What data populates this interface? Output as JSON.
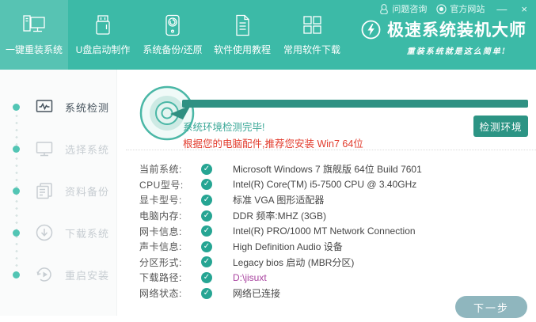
{
  "titlebar": {
    "help_label": "问题咨询",
    "official_label": "官方网站",
    "minimize_glyph": "—",
    "close_glyph": "×"
  },
  "header": {
    "tabs": [
      {
        "label": "一键重装系统",
        "icon": "computer-icon",
        "active": true
      },
      {
        "label": "U盘启动制作",
        "icon": "usb-drive-icon",
        "active": false
      },
      {
        "label": "系统备份/还原",
        "icon": "backup-restore-icon",
        "active": false
      },
      {
        "label": "软件使用教程",
        "icon": "tutorial-document-icon",
        "active": false
      },
      {
        "label": "常用软件下载",
        "icon": "apps-grid-icon",
        "active": false
      }
    ],
    "brand": {
      "title": "极速系统装机大师",
      "tagline": "重装系统就是这么简单!"
    }
  },
  "sidebar": {
    "steps": [
      {
        "label": "系统检测",
        "icon": "monitor-pulse-icon",
        "active": true
      },
      {
        "label": "选择系统",
        "icon": "monitor-icon",
        "active": false
      },
      {
        "label": "资料备份",
        "icon": "documents-icon",
        "active": false
      },
      {
        "label": "下载系统",
        "icon": "download-circle-icon",
        "active": false
      },
      {
        "label": "重启安装",
        "icon": "restart-icon",
        "active": false
      }
    ]
  },
  "main": {
    "progress_percent": 100,
    "status": "系统环境检测完毕!",
    "recommendation": "根据您的电脑配件,推荐您安装 Win7 64位",
    "detect_button": "检测环境",
    "rows": [
      {
        "label": "当前系统:",
        "value": "Microsoft Windows 7 旗舰版 64位 Build 7601"
      },
      {
        "label": "CPU型号:",
        "value": "Intel(R) Core(TM) i5-7500 CPU @ 3.40GHz"
      },
      {
        "label": "显卡型号:",
        "value": "标准 VGA 图形适配器"
      },
      {
        "label": "电脑内存:",
        "value": "DDR 频率:MHZ (3GB)"
      },
      {
        "label": "网卡信息:",
        "value": "Intel(R) PRO/1000 MT Network Connection"
      },
      {
        "label": "声卡信息:",
        "value": "High Definition Audio 设备"
      },
      {
        "label": "分区形式:",
        "value": "Legacy bios 启动 (MBR分区)"
      },
      {
        "label": "下载路径:",
        "value": "D:\\jisuxt",
        "highlight": true
      },
      {
        "label": "网络状态:",
        "value": "网络已连接"
      }
    ],
    "next_button": "下一步"
  },
  "icons": {
    "check_glyph": "✓"
  },
  "colors": {
    "header_teal": "#3cbaa7",
    "dark_teal": "#2f9183",
    "status_teal": "#3aa797",
    "alert_red": "#e23b2c",
    "check_green": "#26a593",
    "path_purple": "#a944a0",
    "next_button_gray_blue": "#8fb6be",
    "step_dot_teal": "#52c5b4"
  }
}
